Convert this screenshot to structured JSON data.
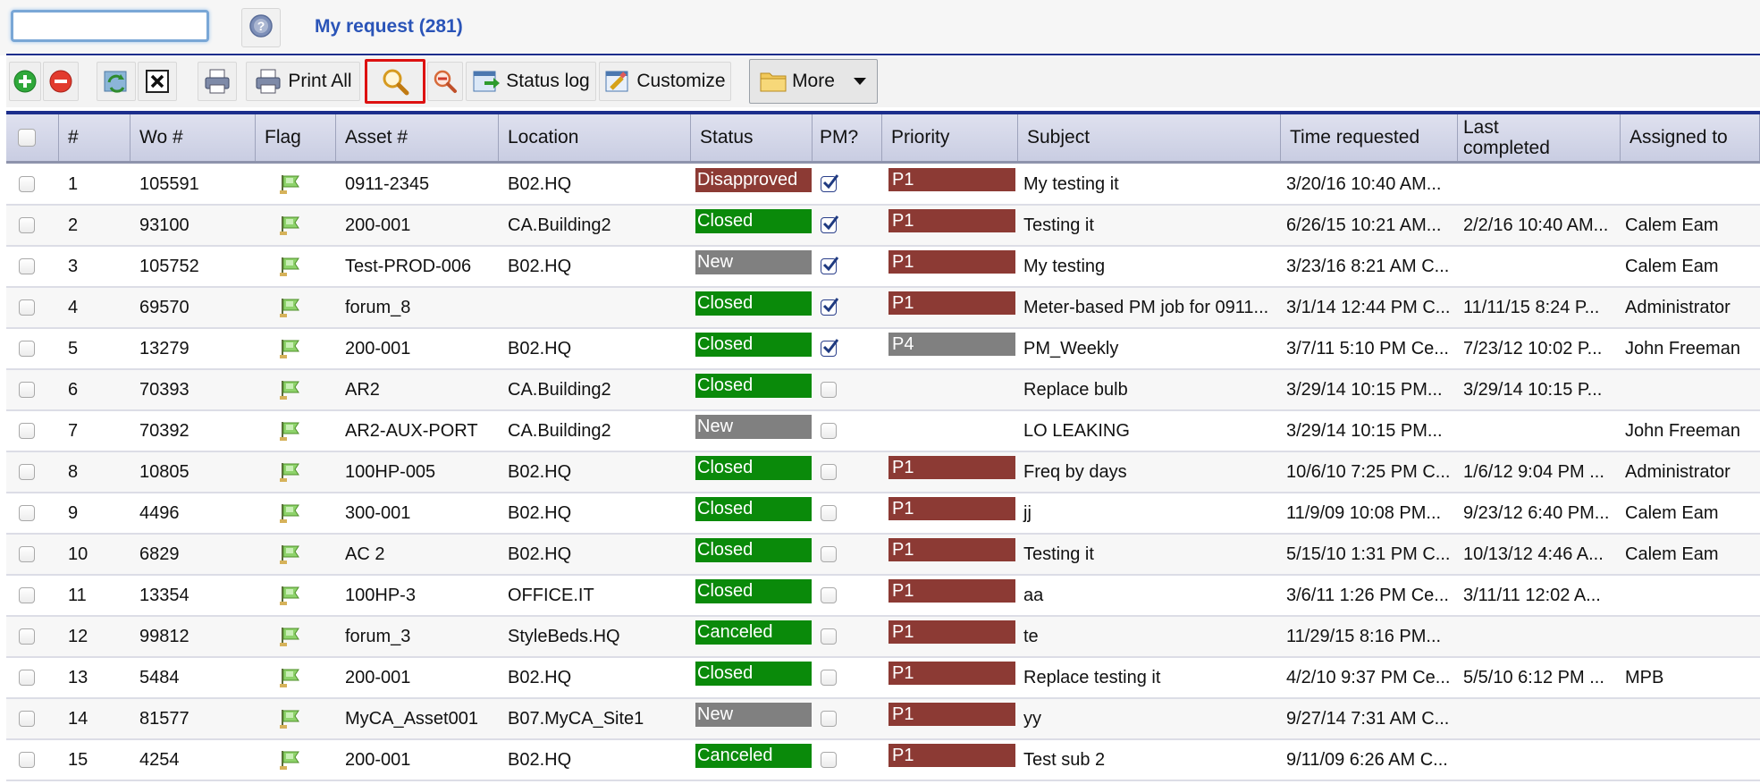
{
  "header": {
    "search_value": "",
    "help_icon": "help-icon",
    "title": "My request (281)"
  },
  "toolbar": {
    "print_all_label": "Print All",
    "status_log_label": "Status log",
    "customize_label": "Customize",
    "more_label": "More"
  },
  "colors": {
    "accent": "#1c2e8c",
    "title": "#2a54b8",
    "status_closed": "#0a8a0a",
    "status_disapproved": "#8c3a34",
    "status_new": "#808080",
    "status_canceled": "#0a8a0a",
    "priority_p1": "#8c3a34",
    "priority_p4": "#808080"
  },
  "table": {
    "columns": [
      "#",
      "Wo #",
      "Flag",
      "Asset #",
      "Location",
      "Status",
      "PM?",
      "Priority",
      "Subject",
      "Time requested",
      "Last completed",
      "Assigned to"
    ],
    "rows": [
      {
        "num": "1",
        "wo": "105591",
        "asset": "0911-2345",
        "location": "B02.HQ",
        "status": "Disapproved",
        "pm": true,
        "priority": "P1",
        "subject": "My testing it",
        "time_requested": "3/20/16 10:40 AM...",
        "last_completed": "",
        "assigned_to": ""
      },
      {
        "num": "2",
        "wo": "93100",
        "asset": "200-001",
        "location": "CA.Building2",
        "status": "Closed",
        "pm": true,
        "priority": "P1",
        "subject": "Testing it",
        "time_requested": "6/26/15 10:21 AM...",
        "last_completed": "2/2/16 10:40 AM...",
        "assigned_to": "Calem Eam"
      },
      {
        "num": "3",
        "wo": "105752",
        "asset": "Test-PROD-006",
        "location": "B02.HQ",
        "status": "New",
        "pm": true,
        "priority": "P1",
        "subject": "My testing",
        "time_requested": "3/23/16 8:21 AM C...",
        "last_completed": "",
        "assigned_to": "Calem Eam"
      },
      {
        "num": "4",
        "wo": "69570",
        "asset": "forum_8",
        "location": "",
        "status": "Closed",
        "pm": true,
        "priority": "P1",
        "subject": "Meter-based PM job for 0911...",
        "time_requested": "3/1/14 12:44 PM C...",
        "last_completed": "11/11/15 8:24 P...",
        "assigned_to": "Administrator"
      },
      {
        "num": "5",
        "wo": "13279",
        "asset": "200-001",
        "location": "B02.HQ",
        "status": "Closed",
        "pm": true,
        "priority": "P4",
        "subject": "PM_Weekly",
        "time_requested": "3/7/11 5:10 PM Ce...",
        "last_completed": "7/23/12 10:02 P...",
        "assigned_to": "John Freeman"
      },
      {
        "num": "6",
        "wo": "70393",
        "asset": "AR2",
        "location": "CA.Building2",
        "status": "Closed",
        "pm": false,
        "priority": "",
        "subject": "Replace bulb",
        "time_requested": "3/29/14 10:15 PM...",
        "last_completed": "3/29/14 10:15 P...",
        "assigned_to": ""
      },
      {
        "num": "7",
        "wo": "70392",
        "asset": "AR2-AUX-PORT",
        "location": "CA.Building2",
        "status": "New",
        "pm": false,
        "priority": "",
        "subject": "LO LEAKING",
        "time_requested": "3/29/14 10:15 PM...",
        "last_completed": "",
        "assigned_to": "John Freeman"
      },
      {
        "num": "8",
        "wo": "10805",
        "asset": "100HP-005",
        "location": "B02.HQ",
        "status": "Closed",
        "pm": false,
        "priority": "P1",
        "subject": "Freq by days",
        "time_requested": "10/6/10 7:25 PM C...",
        "last_completed": "1/6/12 9:04 PM ...",
        "assigned_to": "Administrator"
      },
      {
        "num": "9",
        "wo": "4496",
        "asset": "300-001",
        "location": "B02.HQ",
        "status": "Closed",
        "pm": false,
        "priority": "P1",
        "subject": "jj",
        "time_requested": "11/9/09 10:08 PM...",
        "last_completed": "9/23/12 6:40 PM...",
        "assigned_to": "Calem Eam"
      },
      {
        "num": "10",
        "wo": "6829",
        "asset": "AC 2",
        "location": "B02.HQ",
        "status": "Closed",
        "pm": false,
        "priority": "P1",
        "subject": "Testing it",
        "time_requested": "5/15/10 1:31 PM C...",
        "last_completed": "10/13/12 4:46 A...",
        "assigned_to": "Calem Eam"
      },
      {
        "num": "11",
        "wo": "13354",
        "asset": "100HP-3",
        "location": "OFFICE.IT",
        "status": "Closed",
        "pm": false,
        "priority": "P1",
        "subject": "aa",
        "time_requested": "3/6/11 1:26 PM Ce...",
        "last_completed": "3/11/11 12:02 A...",
        "assigned_to": ""
      },
      {
        "num": "12",
        "wo": "99812",
        "asset": "forum_3",
        "location": "StyleBeds.HQ",
        "status": "Canceled",
        "pm": false,
        "priority": "P1",
        "subject": "te",
        "time_requested": "11/29/15 8:16 PM...",
        "last_completed": "",
        "assigned_to": ""
      },
      {
        "num": "13",
        "wo": "5484",
        "asset": "200-001",
        "location": "B02.HQ",
        "status": "Closed",
        "pm": false,
        "priority": "P1",
        "subject": "Replace testing it",
        "time_requested": "4/2/10 9:37 PM Ce...",
        "last_completed": "5/5/10 6:12 PM ...",
        "assigned_to": "MPB"
      },
      {
        "num": "14",
        "wo": "81577",
        "asset": "MyCA_Asset001",
        "location": "B07.MyCA_Site1",
        "status": "New",
        "pm": false,
        "priority": "P1",
        "subject": "yy",
        "time_requested": "9/27/14 7:31 AM C...",
        "last_completed": "",
        "assigned_to": ""
      },
      {
        "num": "15",
        "wo": "4254",
        "asset": "200-001",
        "location": "B02.HQ",
        "status": "Canceled",
        "pm": false,
        "priority": "P1",
        "subject": "Test sub 2",
        "time_requested": "9/11/09 6:26 AM C...",
        "last_completed": "",
        "assigned_to": ""
      }
    ]
  }
}
